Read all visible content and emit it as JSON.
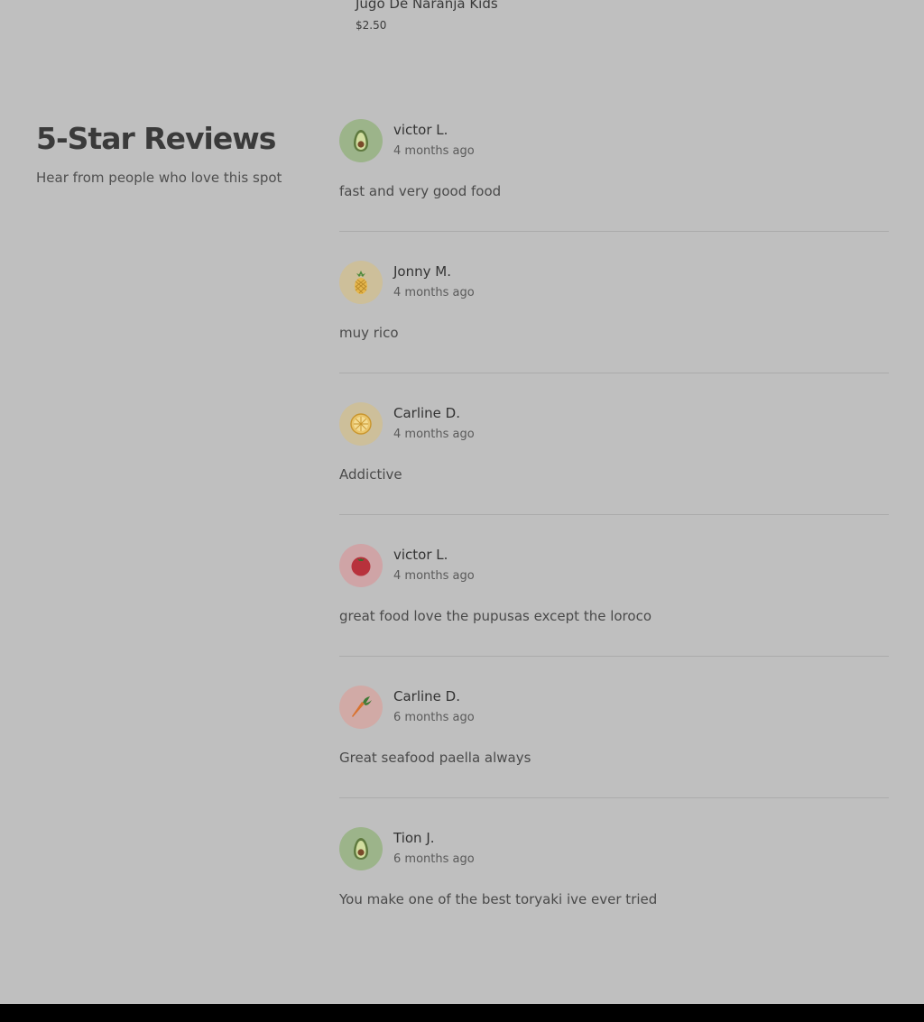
{
  "top_item": {
    "name": "Jugo De Naranja Kids",
    "price": "$2.50"
  },
  "reviews_section": {
    "title": "5-Star Reviews",
    "subtitle": "Hear from people who love this spot"
  },
  "reviews": [
    {
      "name": "victor L.",
      "time": "4 months ago",
      "text": "fast and very good food",
      "avatar_icon": "avocado-icon",
      "avatar_color": "#9cb48a"
    },
    {
      "name": "Jonny M.",
      "time": "4 months ago",
      "text": "muy rico",
      "avatar_icon": "pineapple-icon",
      "avatar_color": "#cdbf9a"
    },
    {
      "name": "Carline D.",
      "time": "4 months ago",
      "text": "Addictive",
      "avatar_icon": "lemon-icon",
      "avatar_color": "#cdbf9a"
    },
    {
      "name": "victor L.",
      "time": "4 months ago",
      "text": "great food love the pupusas except the loroco",
      "avatar_icon": "tomato-icon",
      "avatar_color": "#cfa4a6"
    },
    {
      "name": "Carline D.",
      "time": "6 months ago",
      "text": "Great seafood paella always",
      "avatar_icon": "carrot-icon",
      "avatar_color": "#d1aaa6"
    },
    {
      "name": "Tion J.",
      "time": "6 months ago",
      "text": "You make one of the best toryaki ive ever tried",
      "avatar_icon": "avocado-icon",
      "avatar_color": "#9cb48a"
    }
  ]
}
